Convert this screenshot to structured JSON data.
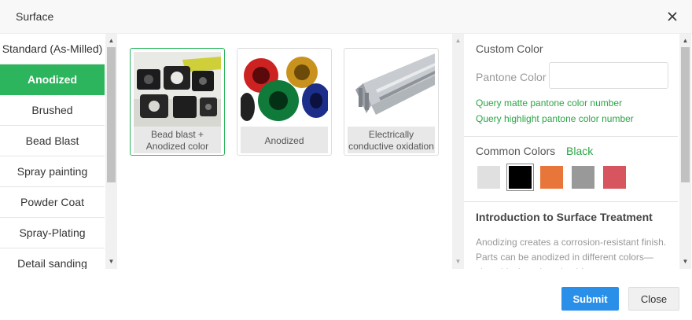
{
  "dialog": {
    "title": "Surface",
    "close_icon": "close-icon"
  },
  "sidebar": {
    "items": [
      {
        "label": "Standard (As-Milled)",
        "active": false
      },
      {
        "label": "Anodized",
        "active": true
      },
      {
        "label": "Brushed",
        "active": false
      },
      {
        "label": "Bead Blast",
        "active": false
      },
      {
        "label": "Spray painting",
        "active": false
      },
      {
        "label": "Powder Coat",
        "active": false
      },
      {
        "label": "Spray-Plating",
        "active": false
      },
      {
        "label": "Detail sanding",
        "active": false
      }
    ]
  },
  "options": [
    {
      "label": "Bead blast + Anodized color",
      "selected": true,
      "image": "black-anodized-parts"
    },
    {
      "label": "Anodized",
      "selected": false,
      "image": "colored-anodized-cylinders"
    },
    {
      "label": "Electrically conductive oxidation",
      "selected": false,
      "image": "aluminum-extrusion-profile"
    }
  ],
  "custom_color": {
    "title": "Custom Color",
    "pantone_label": "Pantone Color",
    "pantone_value": "",
    "query_matte": "Query matte pantone color number",
    "query_highlight": "Query highlight pantone color number"
  },
  "common_colors": {
    "title": "Common Colors",
    "selected_name": "Black",
    "swatches": [
      {
        "name": "light-gray",
        "color": "#e0e0e0",
        "selected": false
      },
      {
        "name": "black",
        "color": "#000000",
        "selected": true
      },
      {
        "name": "orange",
        "color": "#e8763a",
        "selected": false
      },
      {
        "name": "gray",
        "color": "#999999",
        "selected": false
      },
      {
        "name": "red",
        "color": "#d6555f",
        "selected": false
      }
    ]
  },
  "intro": {
    "title": "Introduction to Surface Treatment",
    "text": "Anodizing creates a corrosion-resistant finish. Parts can be anodized in different colors—clear, black, red, and gold are most common"
  },
  "footer": {
    "submit_label": "Submit",
    "close_label": "Close"
  },
  "colors": {
    "accent_green": "#2db55d",
    "link_green": "#2aa545",
    "submit_blue": "#2a8fe8"
  }
}
